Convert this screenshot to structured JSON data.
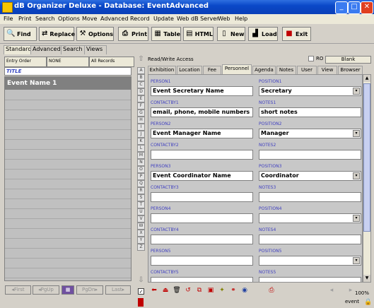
{
  "window": {
    "title": "dB Organizer Deluxe - Database: EventAdvanced",
    "minimize": "_",
    "maximize": "□",
    "close": "✕"
  },
  "menu": [
    "File",
    "Print",
    "Search",
    "Options",
    "Move",
    "Advanced",
    "Record",
    "Update",
    "Web dB Server",
    "Web",
    "Help"
  ],
  "toolbar": [
    {
      "label": "Find",
      "icon": "search-icon",
      "glyph": "🔍"
    },
    {
      "label": "Replace",
      "icon": "replace-icon",
      "glyph": "⇄"
    },
    {
      "label": "Options",
      "icon": "options-icon",
      "glyph": "⚒"
    },
    {
      "label": "Print",
      "icon": "printer-icon",
      "glyph": "⎙"
    },
    {
      "label": "Table",
      "icon": "table-icon",
      "glyph": "▦"
    },
    {
      "label": "HTML",
      "icon": "html-icon",
      "glyph": "▤"
    },
    {
      "label": "New",
      "icon": "new-icon",
      "glyph": "▯"
    },
    {
      "label": "Load",
      "icon": "load-icon",
      "glyph": "▟"
    },
    {
      "label": "Exit",
      "icon": "exit-icon",
      "glyph": "■"
    }
  ],
  "left_tabs": [
    "Standard",
    "Advanced",
    "Search",
    "Views"
  ],
  "sort_buttons": [
    "Entry Order",
    "NONE",
    "All Records"
  ],
  "list_header": "TITLE",
  "list_items": [
    "Event Name 1"
  ],
  "nav_buttons": [
    "First",
    "PgUp",
    "PgDn",
    "Last"
  ],
  "az_letters": [
    "A",
    "B",
    "C",
    "D",
    "E",
    "F",
    "G",
    "H",
    "I",
    "J",
    "K",
    "L",
    "M",
    "N",
    "O",
    "P",
    "Q",
    "R",
    "S",
    "T",
    "U",
    "V",
    "W",
    "X",
    "Y",
    "Z"
  ],
  "access": {
    "label": "Read/Write Access",
    "ro": "RO",
    "blank": "Blank"
  },
  "tabs": [
    "Exhibition",
    "Location",
    "Fee",
    "Personnel",
    "Agenda",
    "Notes",
    "User",
    "View",
    "Browser"
  ],
  "active_tab": "Personnel",
  "fields": [
    {
      "person_label": "PERSON1",
      "person": "Event Secretary Name",
      "position_label": "POSITION1",
      "position": "Secretary",
      "contact_label": "CONTACTBY1",
      "contact": "email,  phone, mobile numbers",
      "notes_label": "NOTES1",
      "notes": "short notes"
    },
    {
      "person_label": "PERSON2",
      "person": "Event Manager Name",
      "position_label": "POSITION2",
      "position": "Manager",
      "contact_label": "CONTACTBY2",
      "contact": "",
      "notes_label": "NOTES2",
      "notes": ""
    },
    {
      "person_label": "PERSON3",
      "person": "Event Coordinator Name",
      "position_label": "POSITION3",
      "position": "Coordinator",
      "contact_label": "CONTACTBY3",
      "contact": "",
      "notes_label": "NOTES3",
      "notes": ""
    },
    {
      "person_label": "PERSON4",
      "person": "",
      "position_label": "POSITION4",
      "position": "",
      "contact_label": "CONTACTBY4",
      "contact": "",
      "notes_label": "NOTES4",
      "notes": ""
    },
    {
      "person_label": "PERSON5",
      "person": "",
      "position_label": "POSITION5",
      "position": "",
      "contact_label": "CONTACTBY5",
      "contact": "",
      "notes_label": "NOTES5",
      "notes": ""
    }
  ],
  "status": {
    "zoom": "100%",
    "user": "event"
  }
}
